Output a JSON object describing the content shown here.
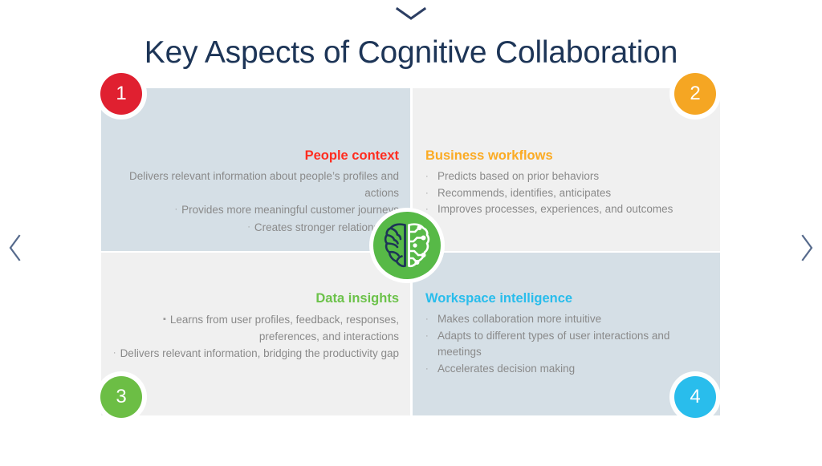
{
  "slide": {
    "title": "Key Aspects of Cognitive Collaboration"
  },
  "nav": {
    "top_chevron_name": "chevron-down-icon",
    "prev_label": "‹",
    "next_label": "›"
  },
  "center_icon": {
    "name": "brain-circuit-icon",
    "circle_color": "#57b947",
    "left_hemisphere_color": "#1d3557",
    "right_hemisphere_color": "#ffffff"
  },
  "quadrants": [
    {
      "number": "1",
      "badge_color": "#e02030",
      "background": "#d5dfe6",
      "heading": "People context",
      "heading_color": "#ff2d20",
      "align": "right",
      "bullets": [
        "Delivers relevant information about people’s profiles and actions",
        "Provides more meaningful customer journeys",
        "Creates stronger relationships"
      ]
    },
    {
      "number": "2",
      "badge_color": "#f5a623",
      "background": "#f0f0f0",
      "heading": "Business workflows",
      "heading_color": "#fbab24",
      "align": "left",
      "bullets": [
        "Predicts based on prior behaviors",
        "Recommends, identifies, anticipates",
        "Improves processes, experiences, and outcomes"
      ]
    },
    {
      "number": "3",
      "badge_color": "#6cbe45",
      "background": "#f0f0f0",
      "heading": "Data insights",
      "heading_color": "#6cc24a",
      "align": "right",
      "bullets": [
        "Learns from user profiles, feedback, responses, preferences, and interactions",
        "Delivers relevant information, bridging the productivity gap"
      ]
    },
    {
      "number": "4",
      "badge_color": "#29bdec",
      "background": "#d5dfe6",
      "heading": "Workspace intelligence",
      "heading_color": "#29bdec",
      "align": "left",
      "bullets": [
        "Makes collaboration more intuitive",
        "Adapts to different types of user interactions and meetings",
        "Accelerates decision making"
      ]
    }
  ],
  "bullet_glyph": "·",
  "bullet_glyph_square": "▪"
}
